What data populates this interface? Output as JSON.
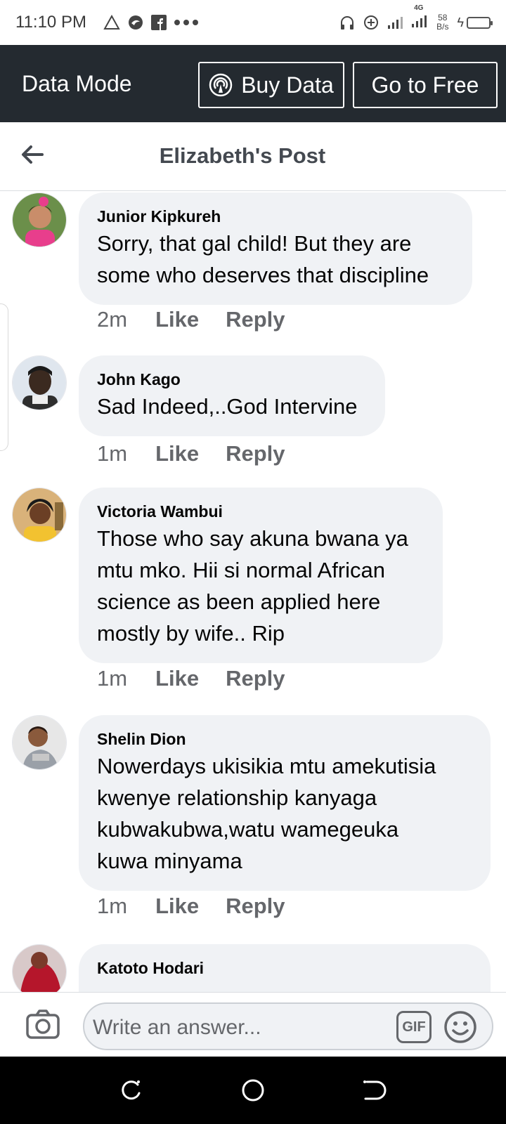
{
  "status_bar": {
    "time": "11:10 PM",
    "left_icons": [
      "warning-icon",
      "bird-icon",
      "facebook-icon",
      "more-dots-icon"
    ],
    "right_icons": [
      "headphones-icon",
      "data-saver-icon",
      "signal-icon",
      "signal-4g-icon",
      "battery-charging-icon"
    ],
    "net_speed_value": "58",
    "net_speed_unit": "B/s",
    "network": "4G"
  },
  "data_bar": {
    "title": "Data Mode",
    "buy_label": "Buy Data",
    "free_label": "Go to Free"
  },
  "header": {
    "title": "Elizabeth's Post"
  },
  "comments": [
    {
      "author": "Junior Kipkureh",
      "lines": [
        "Sorry, that gal child! But they are",
        "some who deserves that discipline"
      ],
      "time": "2m",
      "like": "Like",
      "reply": "Reply"
    },
    {
      "author": "John Kago",
      "lines": [
        "Sad Indeed,..God Intervine"
      ],
      "time": "1m",
      "like": "Like",
      "reply": "Reply"
    },
    {
      "author": "Victoria Wambui",
      "lines": [
        "Those who say akuna bwana ya",
        "mtu mko. Hii si normal African",
        "science as been applied here",
        "mostly by wife.. Rip"
      ],
      "time": "1m",
      "like": "Like",
      "reply": "Reply"
    },
    {
      "author": "Shelin Dion",
      "lines": [
        "Nowerdays ukisikia mtu amekutisia",
        "kwenye relationship kanyaga",
        "kubwakubwa,watu wamegeuka",
        "kuwa minyama"
      ],
      "time": "1m",
      "like": "Like",
      "reply": "Reply"
    },
    {
      "author": "Katoto Hodari",
      "lines": []
    }
  ],
  "composer": {
    "placeholder": "Write an answer...",
    "gif_label": "GIF"
  },
  "colors": {
    "data_bar_bg": "#242a30",
    "bubble_bg": "#f0f2f5",
    "secondary_text": "#65676b"
  }
}
